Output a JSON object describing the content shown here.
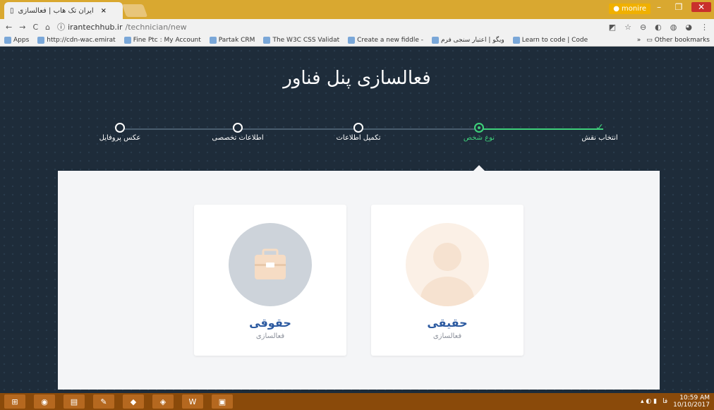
{
  "browser": {
    "tab_title": "ایران تک هاب | فعالسازی",
    "tab_close": "×",
    "user_name": "monire",
    "url_host": "irantechhub.ir",
    "url_path": "/technician/new",
    "bookmarks": [
      "Apps",
      "http://cdn-wac.emirat",
      "Fine Ptc : My Account",
      "Partak CRM",
      "The W3C CSS Validat",
      "Create a new fiddle -",
      "ویگو | اعتبار سنجی فرم",
      "Learn to code | Code"
    ],
    "more": "»",
    "other_bookmarks": "Other bookmarks"
  },
  "page": {
    "title": "فعالسازی پنل فناور",
    "steps": [
      "عکس پروفایل",
      "اطلاعات تخصصی",
      "تکمیل اطلاعات",
      "نوع شخص",
      "انتخاب نقش"
    ],
    "cards": [
      {
        "title": "حقوقی",
        "subtitle": "فعالسازی",
        "icon": "briefcase-icon"
      },
      {
        "title": "حقیقی",
        "subtitle": "فعالسازی",
        "icon": "person-icon"
      }
    ]
  },
  "taskbar": {
    "time": "10:59 AM",
    "date": "10/10/2017",
    "lang": "فا"
  },
  "colors": {
    "accent": "#3ecf7a",
    "card_title": "#2c5aa0",
    "bg": "#1e2c3a"
  }
}
